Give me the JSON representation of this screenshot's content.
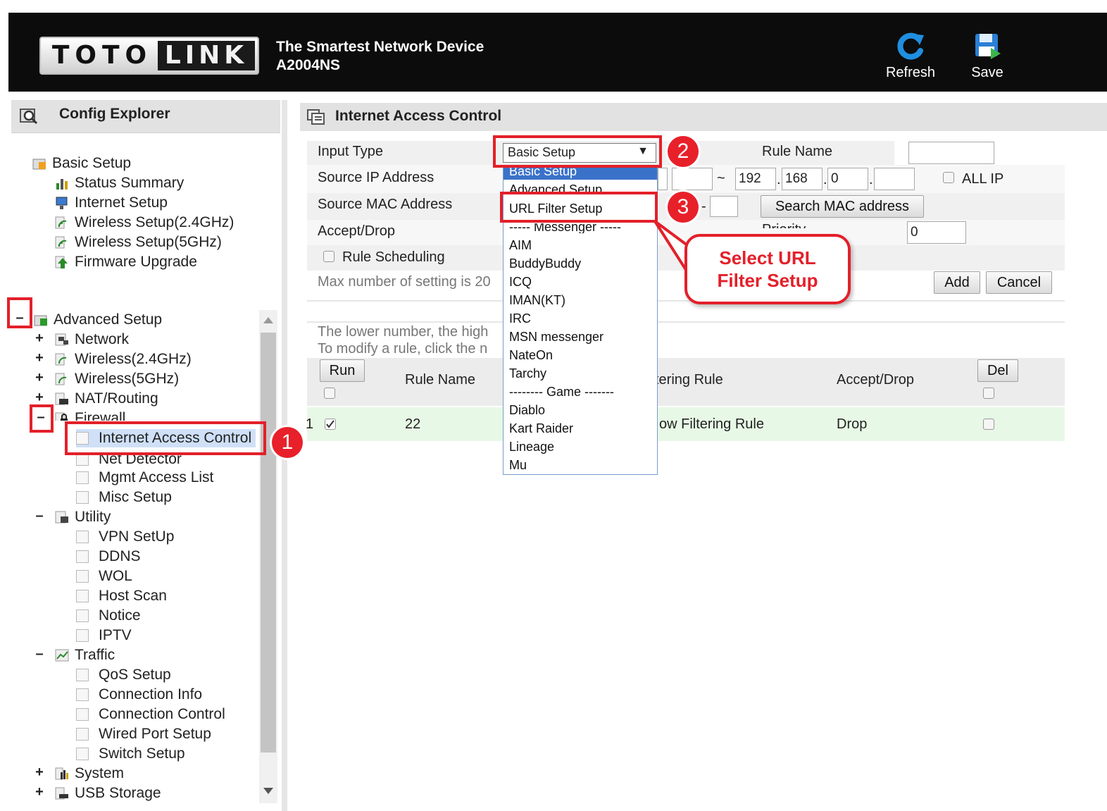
{
  "header": {
    "logo_left": "TOTO",
    "logo_right": "LINK",
    "tagline": "The Smartest Network Device",
    "model": "A2004NS",
    "refresh_label": "Refresh",
    "save_label": "Save",
    "refresh_icon": "refresh-icon",
    "save_icon": "save-icon"
  },
  "sidebar": {
    "title": "Config Explorer",
    "basic_setup": {
      "label": "Basic Setup",
      "items": [
        "Status Summary",
        "Internet Setup",
        "Wireless Setup(2.4GHz)",
        "Wireless Setup(5GHz)",
        "Firmware Upgrade"
      ]
    },
    "advanced_setup": {
      "label": "Advanced Setup",
      "groups": [
        "Network",
        "Wireless(2.4GHz)",
        "Wireless(5GHz)",
        "NAT/Routing"
      ],
      "firewall": {
        "label": "Firewall",
        "items": [
          "Internet Access Control",
          "Net Detector",
          "Mgmt Access List",
          "Misc Setup"
        ]
      },
      "utility": {
        "label": "Utility",
        "items": [
          "VPN SetUp",
          "DDNS",
          "WOL",
          "Host Scan",
          "Notice",
          "IPTV"
        ]
      },
      "traffic": {
        "label": "Traffic",
        "items": [
          "QoS Setup",
          "Connection Info",
          "Connection Control",
          "Wired Port Setup",
          "Switch Setup"
        ]
      },
      "tail_groups": [
        "System",
        "USB Storage"
      ]
    },
    "expand_sign": "+",
    "collapse_sign": "–"
  },
  "main": {
    "title": "Internet Access Control",
    "form": {
      "input_type_label": "Input Type",
      "input_type_value": "Basic Setup",
      "rule_name_label": "Rule Name",
      "rule_name_value": "",
      "source_ip_label": "Source IP Address",
      "tilde": "~",
      "ip_end": [
        "192",
        "168",
        "0",
        ""
      ],
      "dot": ".",
      "all_ip_label": "ALL IP",
      "source_mac_label": "Source MAC Address",
      "mac_dash": "-",
      "search_mac_label": "Search MAC address",
      "accept_drop_label": "Accept/Drop",
      "priority_label": "Priority",
      "priority_value": "0",
      "rule_scheduling_label": "Rule Scheduling",
      "max_note": "Max number of setting is 20",
      "add_label": "Add",
      "cancel_label": "Cancel"
    },
    "notes": [
      "The lower number, the high",
      "To modify a rule, click the n"
    ],
    "table": {
      "run_label": "Run",
      "headers": [
        "Rule Name",
        "tering Rule",
        "Accept/Drop"
      ],
      "del_label": "Del",
      "rows": [
        {
          "index": "1",
          "rule_name": "22",
          "filter": "ow Filtering Rule",
          "action": "Drop"
        }
      ]
    },
    "dropdown_options": [
      "Basic Setup",
      "Advanced Setup",
      "URL Filter Setup",
      "----- Messenger -----",
      "AIM",
      "BuddyBuddy",
      "ICQ",
      "IMAN(KT)",
      "IRC",
      "MSN messenger",
      "NateOn",
      "Tarchy",
      "-------- Game -------",
      "Diablo",
      "Kart Raider",
      "Lineage",
      "Mu"
    ]
  },
  "annotations": {
    "steps": [
      "1",
      "2",
      "3"
    ],
    "callout": [
      "Select URL",
      "Filter Setup"
    ],
    "accent_color": "#e3202a"
  },
  "colors": {
    "header_bg": "#0c0c0c",
    "row_highlight": "#e8f8e6",
    "selected_option": "#3b72c9"
  }
}
